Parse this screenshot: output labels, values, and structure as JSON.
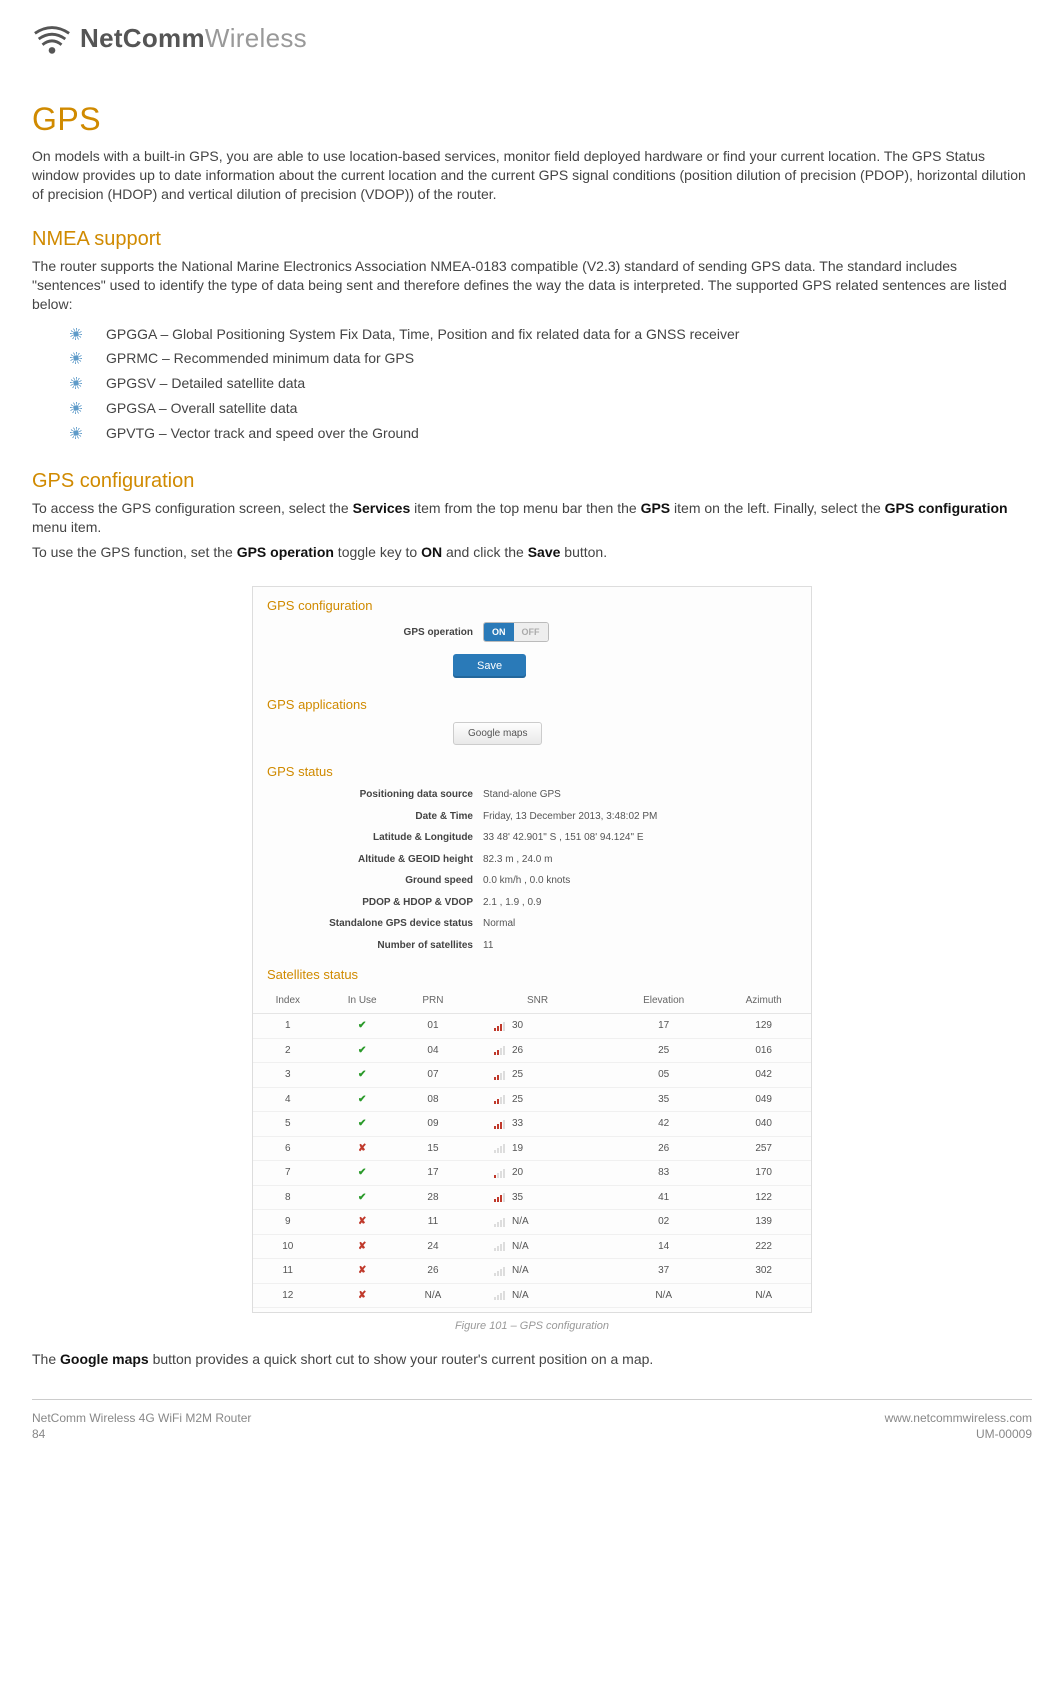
{
  "brand": {
    "bold": "NetComm",
    "light": "Wireless"
  },
  "h1": "GPS",
  "intro": "On models with a built-in GPS, you are able to use location-based services, monitor field deployed hardware or find your current location. The GPS Status window provides up to date information about the current location and the current GPS signal conditions (position dilution of precision (PDOP), horizontal dilution of precision (HDOP) and vertical dilution of precision (VDOP)) of the router.",
  "nmea": {
    "title": "NMEA support",
    "body": "The router supports the National Marine Electronics Association NMEA-0183 compatible (V2.3) standard of sending GPS data. The standard includes \"sentences\" used to identify the type of data being sent and therefore defines the way the data is interpreted. The supported GPS related sentences are listed below:",
    "items": [
      "GPGGA – Global Positioning System Fix Data, Time, Position and fix related data for a GNSS receiver",
      "GPRMC – Recommended minimum data for GPS",
      "GPGSV – Detailed satellite data",
      "GPGSA – Overall satellite data",
      "GPVTG – Vector track and speed over the Ground"
    ]
  },
  "cfg": {
    "title": "GPS configuration",
    "p1_pre": "To access the GPS configuration screen, select the ",
    "p1_b1": "Services",
    "p1_mid1": " item from the top menu bar then the ",
    "p1_b2": "GPS",
    "p1_mid2": " item on the left. Finally, select the ",
    "p1_b3": "GPS configuration",
    "p1_post": " menu item.",
    "p2_pre": "To use the GPS function, set the ",
    "p2_b1": "GPS operation",
    "p2_mid1": " toggle key to ",
    "p2_b2": "ON",
    "p2_mid2": " and click the ",
    "p2_b3": "Save",
    "p2_post": " button."
  },
  "shot": {
    "sec1": "GPS configuration",
    "op_label": "GPS operation",
    "toggle_on": "ON",
    "toggle_off": "OFF",
    "save": "Save",
    "sec2": "GPS applications",
    "gmaps": "Google maps",
    "sec3": "GPS status",
    "status": [
      {
        "l": "Positioning data source",
        "v": "Stand-alone GPS"
      },
      {
        "l": "Date & Time",
        "v": "Friday, 13 December 2013, 3:48:02 PM"
      },
      {
        "l": "Latitude & Longitude",
        "v": "33 48' 42.901\" S ,  151 08' 94.124\" E"
      },
      {
        "l": "Altitude & GEOID height",
        "v": "82.3 m ,  24.0 m"
      },
      {
        "l": "Ground speed",
        "v": "0.0 km/h ,  0.0 knots"
      },
      {
        "l": "PDOP & HDOP & VDOP",
        "v": "2.1 ,  1.9 ,  0.9"
      },
      {
        "l": "Standalone GPS device status",
        "v": "Normal"
      },
      {
        "l": "Number of satellites",
        "v": "11"
      }
    ],
    "sec4": "Satellites status",
    "cols": [
      "Index",
      "In Use",
      "PRN",
      "SNR",
      "Elevation",
      "Azimuth"
    ],
    "rows": [
      {
        "idx": "1",
        "use": true,
        "prn": "01",
        "bars": 3,
        "snr": "30",
        "el": "17",
        "az": "129"
      },
      {
        "idx": "2",
        "use": true,
        "prn": "04",
        "bars": 2,
        "snr": "26",
        "el": "25",
        "az": "016"
      },
      {
        "idx": "3",
        "use": true,
        "prn": "07",
        "bars": 2,
        "snr": "25",
        "el": "05",
        "az": "042"
      },
      {
        "idx": "4",
        "use": true,
        "prn": "08",
        "bars": 2,
        "snr": "25",
        "el": "35",
        "az": "049"
      },
      {
        "idx": "5",
        "use": true,
        "prn": "09",
        "bars": 3,
        "snr": "33",
        "el": "42",
        "az": "040"
      },
      {
        "idx": "6",
        "use": false,
        "prn": "15",
        "bars": 0,
        "snr": "19",
        "el": "26",
        "az": "257"
      },
      {
        "idx": "7",
        "use": true,
        "prn": "17",
        "bars": 1,
        "snr": "20",
        "el": "83",
        "az": "170"
      },
      {
        "idx": "8",
        "use": true,
        "prn": "28",
        "bars": 3,
        "snr": "35",
        "el": "41",
        "az": "122"
      },
      {
        "idx": "9",
        "use": false,
        "prn": "11",
        "bars": 0,
        "snr": "N/A",
        "el": "02",
        "az": "139"
      },
      {
        "idx": "10",
        "use": false,
        "prn": "24",
        "bars": 0,
        "snr": "N/A",
        "el": "14",
        "az": "222"
      },
      {
        "idx": "11",
        "use": false,
        "prn": "26",
        "bars": 0,
        "snr": "N/A",
        "el": "37",
        "az": "302"
      },
      {
        "idx": "12",
        "use": false,
        "prn": "N/A",
        "bars": 0,
        "snr": "N/A",
        "el": "N/A",
        "az": "N/A"
      }
    ]
  },
  "caption": "Figure 101 – GPS configuration",
  "gmaps_line_pre": "The ",
  "gmaps_line_b": "Google maps",
  "gmaps_line_post": " button provides a quick short cut to show your router's current position on a map.",
  "footer": {
    "l1": "NetComm Wireless 4G WiFi M2M Router",
    "l2": "84",
    "r1": "www.netcommwireless.com",
    "r2": "UM-00009"
  }
}
